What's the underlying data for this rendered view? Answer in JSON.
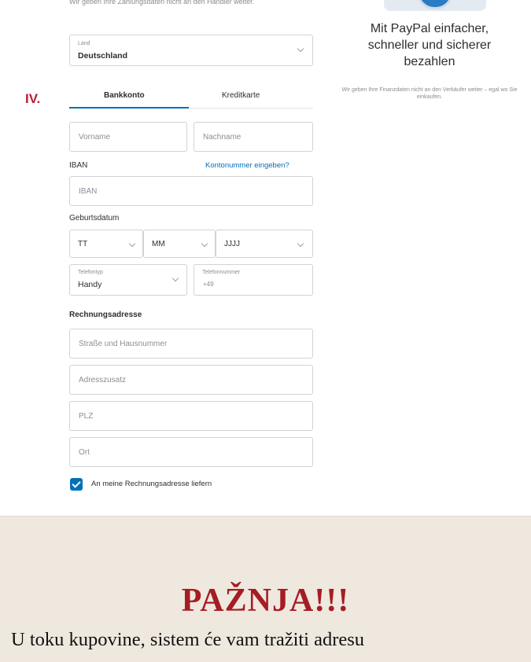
{
  "header_note": "Wir geben Ihre Zahlungsdaten nicht an den Händler weiter.",
  "country": {
    "label": "Land",
    "value": "Deutschland"
  },
  "step_marker": "IV.",
  "tabs": {
    "bank": "Bankkonto",
    "card": "Kreditkarte",
    "active": "bank"
  },
  "fields": {
    "first_name": "Vorname",
    "last_name": "Nachname",
    "iban_label": "IBAN",
    "iban_link": "Kontonummer eingeben?",
    "iban_placeholder": "IBAN",
    "birthdate_label": "Geburtsdatum",
    "day": "TT",
    "month": "MM",
    "year": "JJJJ",
    "phone_type_label": "Telefontyp",
    "phone_type_value": "Handy",
    "phone_number_label": "Telefonnummer",
    "phone_prefix": "+49"
  },
  "billing": {
    "title": "Rechnungsadresse",
    "street": "Straße und Hausnummer",
    "address_extra": "Adresszusatz",
    "zip": "PLZ",
    "city": "Ort",
    "ship_to_billing": "An meine Rechnungsadresse liefern",
    "ship_to_billing_checked": true
  },
  "promo": {
    "title_line1": "Mit PayPal einfacher,",
    "title_line2": "schneller und sicherer",
    "title_line3": "bezahlen",
    "subtitle": "Wir geben Ihre Finanzdaten nicht an den Verkäufer weiter – egal wo Sie einkaufen."
  },
  "warning": {
    "title": "PAŽNJA!!!",
    "text": "U toku kupovine, sistem će vam tražiti adresu"
  },
  "colors": {
    "accent": "#0070ba",
    "step_red": "#b51d3a",
    "warning_red": "#a51d24",
    "background": "#efe8df"
  }
}
